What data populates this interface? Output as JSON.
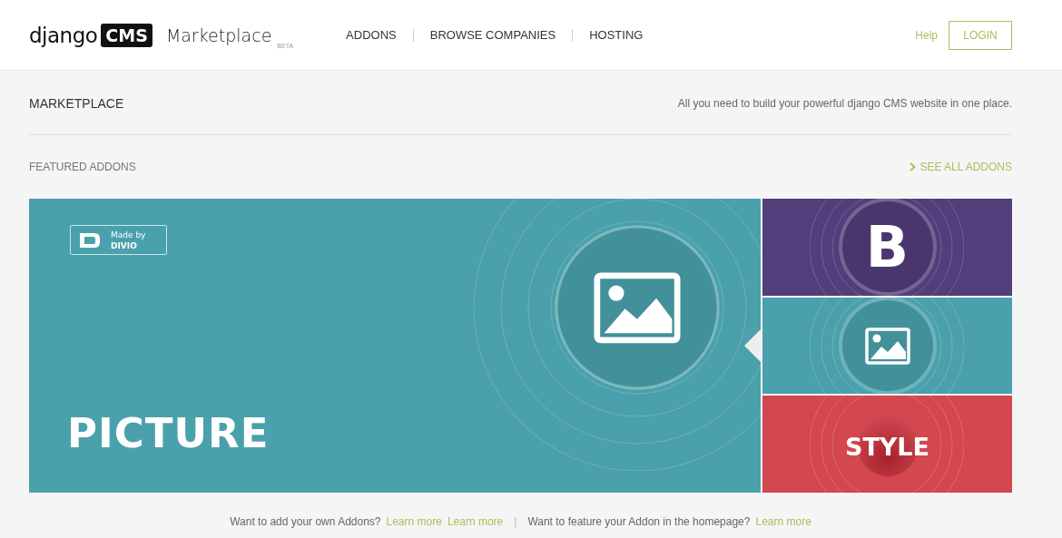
{
  "header": {
    "logo_text": "django",
    "logo_badge": "CMS",
    "product": "Marketplace",
    "product_tag": "BETA",
    "nav": [
      {
        "label": "ADDONS"
      },
      {
        "label": "BROWSE COMPANIES"
      },
      {
        "label": "HOSTING"
      }
    ],
    "help": "Help",
    "login": "LOGIN"
  },
  "page_title": "MARKETPLACE",
  "tagline": "All you need to build your powerful django CMS website in one place.",
  "section_title": "FEATURED ADDONS",
  "see_all": "SEE ALL ADDONS",
  "featured": {
    "title": "PICTURE",
    "badge_line1": "Made by",
    "badge_line2": "DIVIO",
    "color": "#4aa1ac"
  },
  "side_tiles": [
    {
      "kind": "letter",
      "text": "B",
      "color": "#533d7a"
    },
    {
      "kind": "image",
      "color": "#4aa1ac"
    },
    {
      "kind": "word",
      "text": "STYLE",
      "color": "#d4474f"
    }
  ],
  "footer": {
    "question1": "Want to add your own Addons?",
    "links1": [
      "Learn more",
      "Learn more"
    ],
    "separator": "|",
    "question2": "Want to feature your Addon in the homepage?",
    "links2": [
      "Learn more"
    ]
  }
}
